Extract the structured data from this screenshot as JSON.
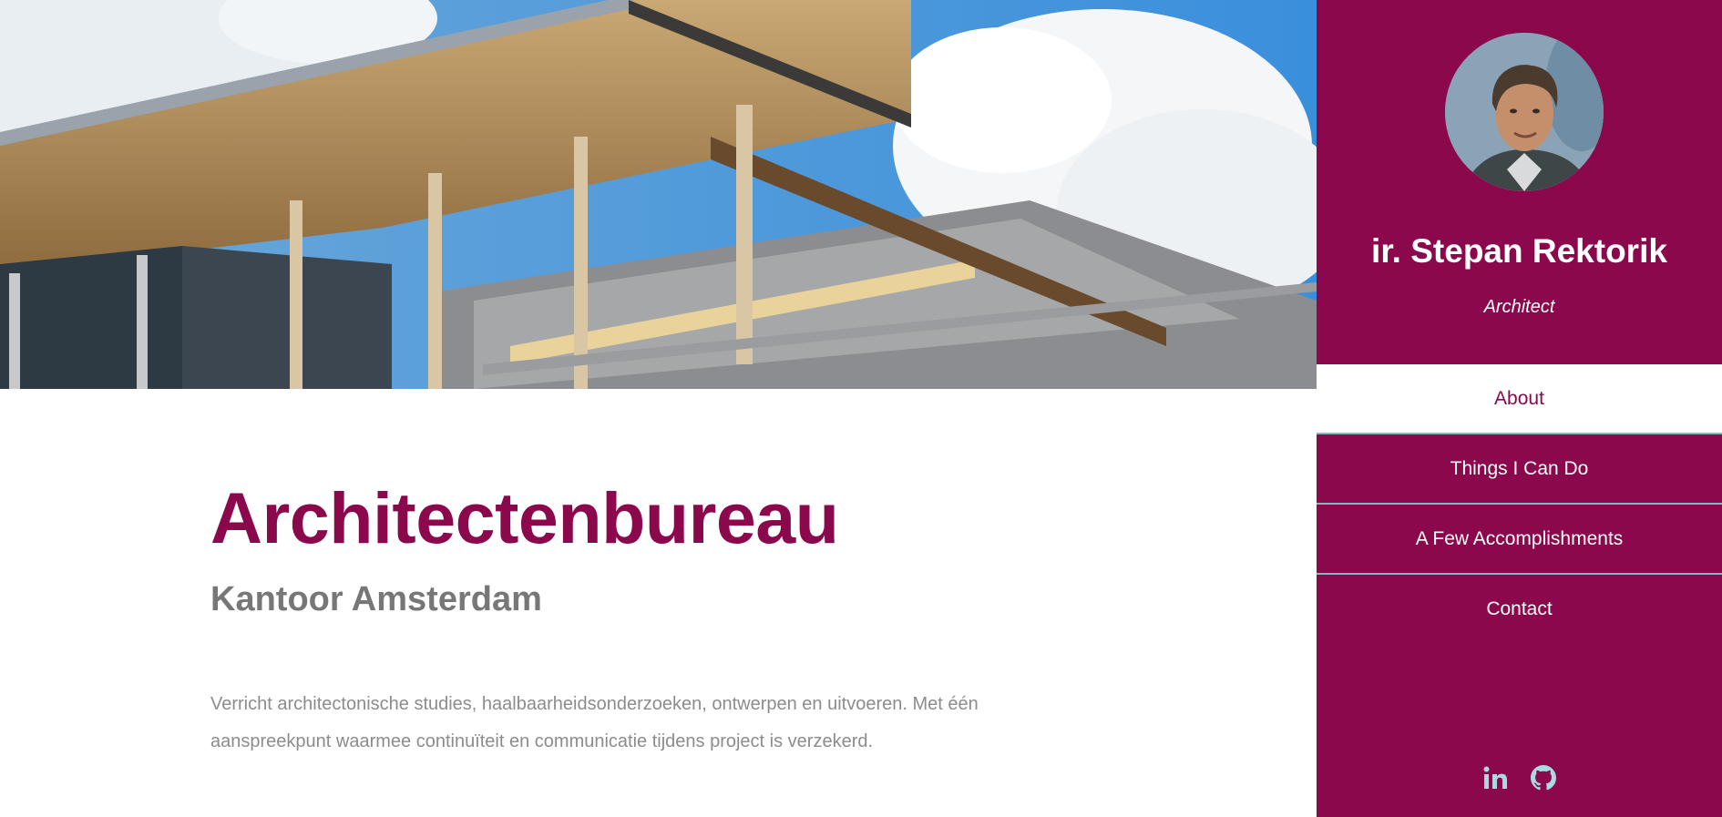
{
  "main": {
    "title": "Architectenbureau",
    "subtitle": "Kantoor Amsterdam",
    "intro": "Verricht architectonische studies, haalbaarheidsonderzoeken, ontwerpen en uitvoeren. Met één aanspreekpunt waarmee continuïteit en communicatie tijdens project is verzekerd."
  },
  "sidebar": {
    "name": "ir. Stepan Rektorik",
    "role": "Architect",
    "nav": [
      {
        "label": "About",
        "active": true
      },
      {
        "label": "Things I Can Do",
        "active": false
      },
      {
        "label": "A Few Accomplishments",
        "active": false
      },
      {
        "label": "Contact",
        "active": false
      }
    ],
    "social": [
      {
        "icon": "linkedin-icon"
      },
      {
        "icon": "github-icon"
      }
    ]
  },
  "colors": {
    "brand": "#8a084b",
    "nav_divider": "#7fb9c4",
    "subtitle_gray": "#777777",
    "body_gray": "#8c8c8c",
    "social_icon": "#a9d9e1"
  }
}
